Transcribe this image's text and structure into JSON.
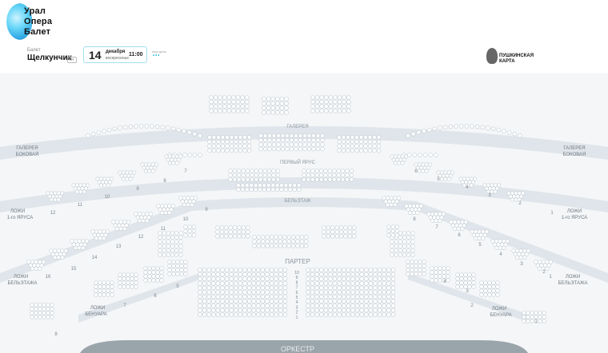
{
  "logo": {
    "line1": "Урал",
    "line2": "Опера",
    "line3": "Балет"
  },
  "event": {
    "category": "Балет",
    "title": "Щелкунчик",
    "age": "6+"
  },
  "date": {
    "day": "14",
    "month": "декабря",
    "weekday": "воскресенье",
    "time": "11:00"
  },
  "more_dates": {
    "label": "еще даты",
    "dots": "•••"
  },
  "pushkin": {
    "label": "ПУШКИНСКАЯ КАРТА"
  },
  "hall": {
    "galereya": "ГАЛЕРЕЯ",
    "perviy_yarus": "ПЕРВЫЙ ЯРУС",
    "beletazh": "БЕЛЬЭТАЖ",
    "parter": "ПАРТЕР",
    "orkestr": "ОРКЕСТР",
    "galereya_bokovaya_left": [
      "ГАЛЕРЕЯ",
      "БОКОВАЯ"
    ],
    "galereya_bokovaya_right": [
      "ГАЛЕРЕЯ",
      "БОКОВАЯ"
    ],
    "lozhi_yarusa_left": [
      "ЛОЖИ",
      "1-го ЯРУСА"
    ],
    "lozhi_yarusa_right": [
      "ЛОЖИ",
      "1-го ЯРУСА"
    ],
    "lozhi_beletazha_left": [
      "ЛОЖИ",
      "БЕЛЬЭТАЖА"
    ],
    "lozhi_beletazha_right": [
      "ЛОЖИ",
      "БЕЛЬЭТАЖА"
    ],
    "lozhi_benuara_left": [
      "ЛОЖИ",
      "БЕНУАРА"
    ],
    "lozhi_benuara_right": [
      "ЛОЖИ",
      "БЕНУАРА"
    ],
    "row_numbers": [
      "10",
      "9",
      "8",
      "7",
      "6",
      "5",
      "4",
      "3",
      "2",
      "1"
    ],
    "box_numbers_yarus_left": [
      "12",
      "11",
      "10",
      "9",
      "8",
      "7"
    ],
    "box_numbers_yarus_right": [
      "6",
      "5",
      "4",
      "3",
      "2",
      "1"
    ],
    "box_numbers_beletazh_left": [
      "16",
      "15",
      "14",
      "13",
      "12",
      "11",
      "10",
      "9"
    ],
    "box_numbers_beletazh_right": [
      "8",
      "7",
      "6",
      "5",
      "4",
      "3",
      "2",
      "1"
    ],
    "box_numbers_benuar_left": [
      "8",
      "7",
      "6",
      "5"
    ],
    "box_numbers_benuar_right": [
      "4",
      "3",
      "2",
      "1"
    ]
  }
}
